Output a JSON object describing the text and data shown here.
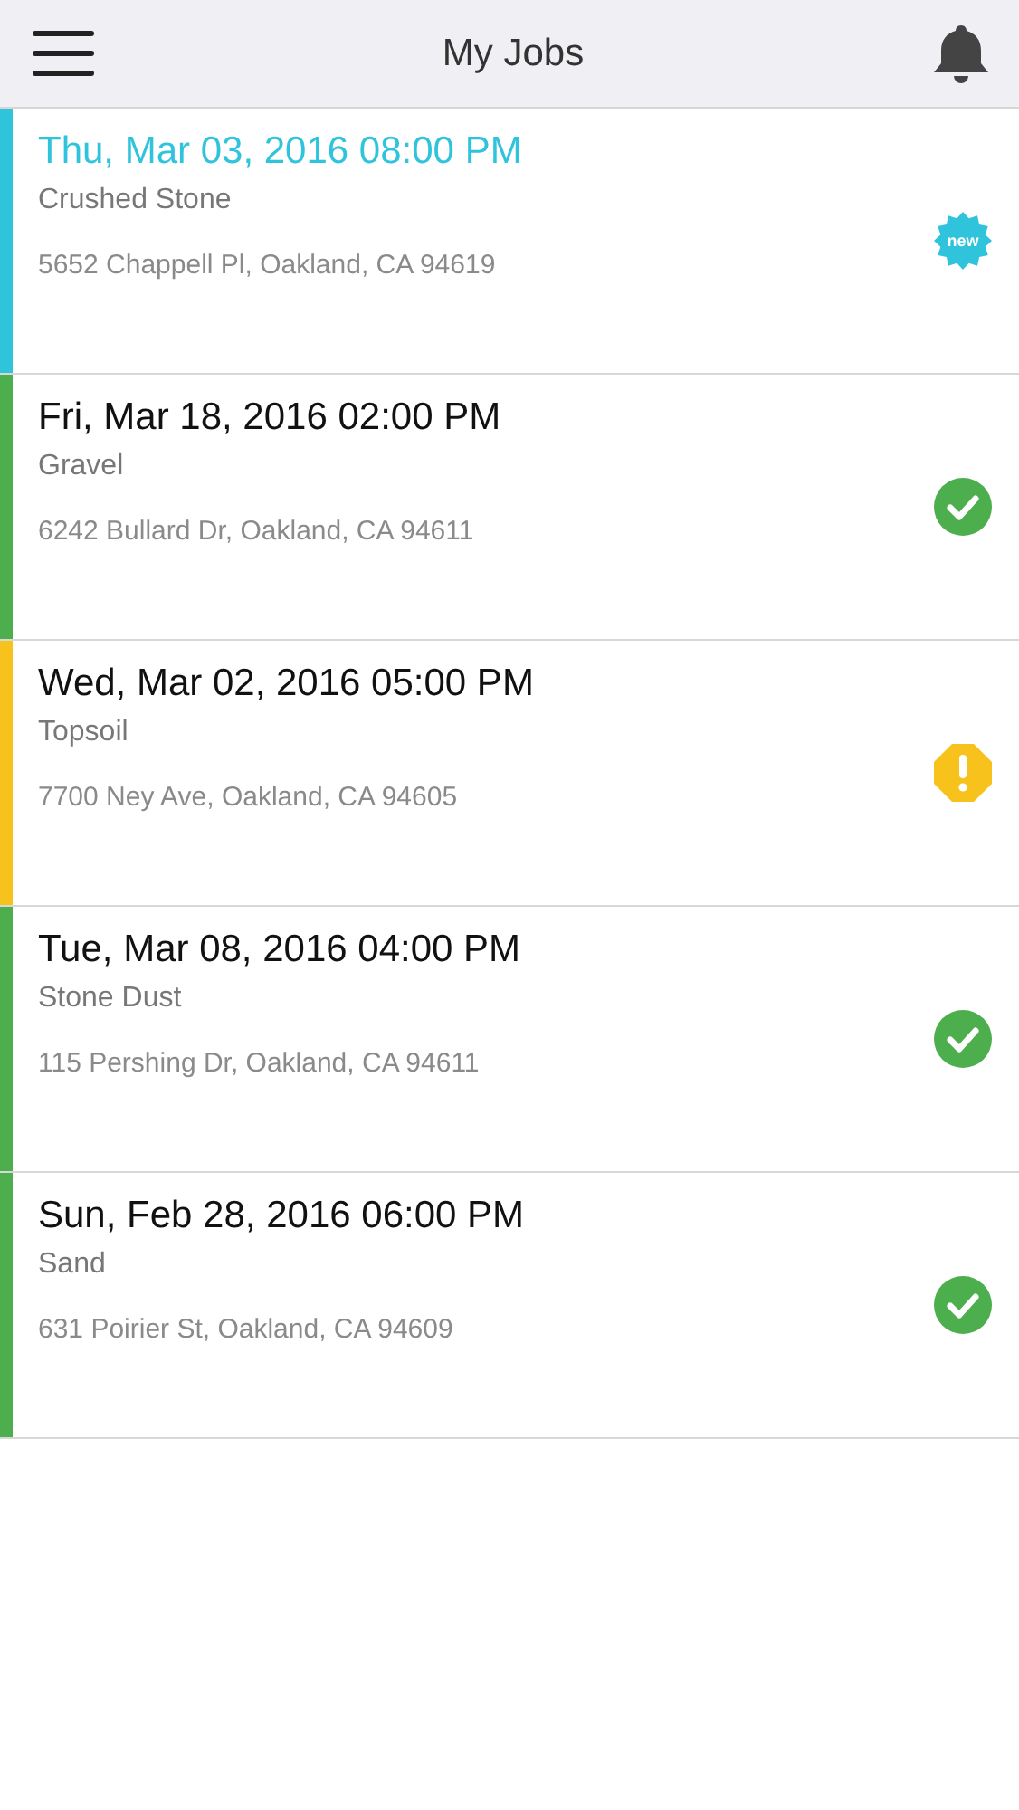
{
  "header": {
    "title": "My Jobs"
  },
  "jobs": [
    {
      "date": "Thu, Mar 03, 2016 08:00 PM",
      "material": "Crushed Stone",
      "address": "5652 Chappell Pl, Oakland, CA 94619",
      "color": "#2fc4dc",
      "kind": "new",
      "badge": "new"
    },
    {
      "date": "Fri, Mar 18, 2016 02:00 PM",
      "material": "Gravel",
      "address": "6242 Bullard Dr, Oakland, CA 94611",
      "color": "#4cae4c",
      "kind": "done"
    },
    {
      "date": "Wed, Mar 02, 2016 05:00 PM",
      "material": "Topsoil",
      "address": "7700 Ney Ave, Oakland, CA 94605",
      "color": "#f8c21c",
      "kind": "warning"
    },
    {
      "date": "Tue, Mar 08, 2016 04:00 PM",
      "material": "Stone Dust",
      "address": "115 Pershing Dr, Oakland, CA 94611",
      "color": "#4cae4c",
      "kind": "done"
    },
    {
      "date": "Sun, Feb 28, 2016 06:00 PM",
      "material": "Sand",
      "address": "631 Poirier St, Oakland, CA 94609",
      "color": "#4cae4c",
      "kind": "done"
    }
  ]
}
